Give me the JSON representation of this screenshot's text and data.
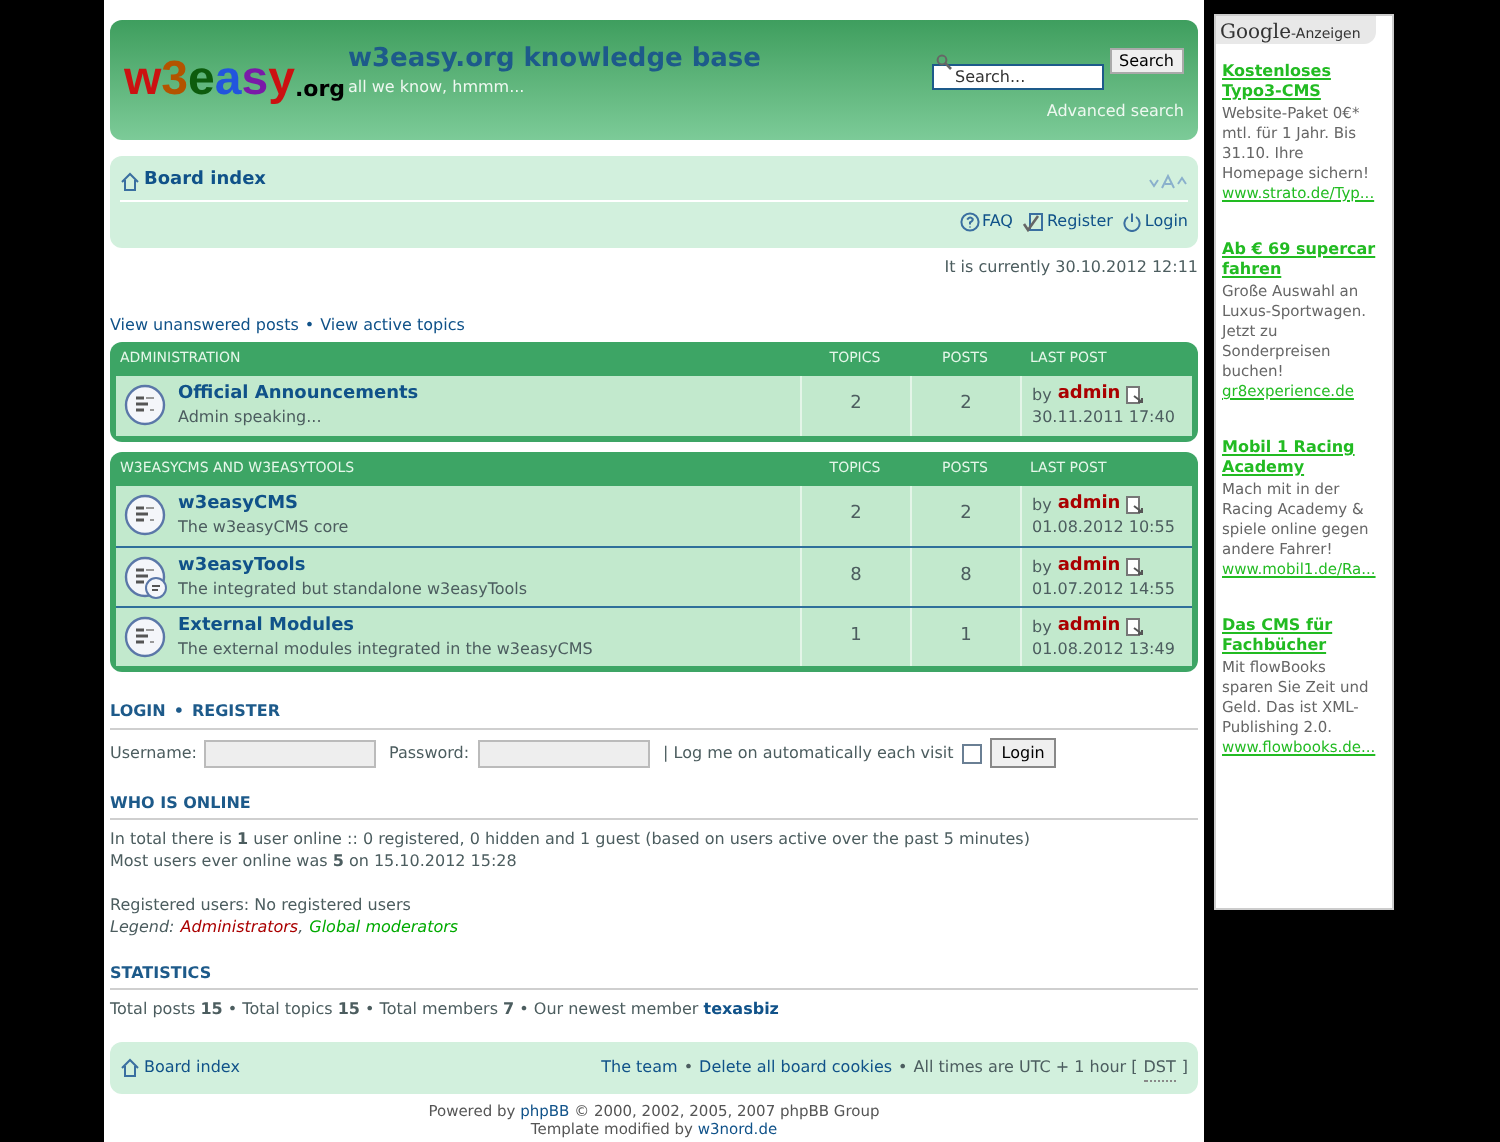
{
  "header": {
    "logo": {
      "main": "w3easy",
      "suffix": ".org"
    },
    "title": "w3easy.org knowledge base",
    "tagline": "all we know, hmmm...",
    "search": {
      "placeholder": "Search...",
      "button": "Search",
      "advanced": "Advanced search"
    }
  },
  "navbar": {
    "breadcrumb": "Board index",
    "links": [
      {
        "kind": "faq",
        "label": "FAQ"
      },
      {
        "kind": "register",
        "label": "Register"
      },
      {
        "kind": "login",
        "label": "Login"
      }
    ]
  },
  "current_time": "It is currently 30.10.2012 12:11",
  "quick_links": [
    "View unanswered posts",
    "View active topics"
  ],
  "separator": "•",
  "categories": [
    {
      "name": "ADMINISTRATION",
      "columns": [
        "TOPICS",
        "POSTS",
        "LAST POST"
      ],
      "forums": [
        {
          "title": "Official Announcements",
          "description": "Admin speaking...",
          "subforums": false,
          "topics": "2",
          "posts": "2",
          "by": "by",
          "author": "admin",
          "date": "30.11.2011 17:40"
        }
      ]
    },
    {
      "name": "W3EASYCMS AND W3EASYTOOLS",
      "columns": [
        "TOPICS",
        "POSTS",
        "LAST POST"
      ],
      "forums": [
        {
          "title": "w3easyCMS",
          "description": "The w3easyCMS core",
          "subforums": false,
          "topics": "2",
          "posts": "2",
          "by": "by",
          "author": "admin",
          "date": "01.08.2012 10:55"
        },
        {
          "title": "w3easyTools",
          "description": "The integrated but standalone w3easyTools",
          "subforums": true,
          "topics": "8",
          "posts": "8",
          "by": "by",
          "author": "admin",
          "date": "01.07.2012 14:55"
        },
        {
          "title": "External Modules",
          "description": "The external modules integrated in the w3easyCMS",
          "subforums": false,
          "topics": "1",
          "posts": "1",
          "by": "by",
          "author": "admin",
          "date": "01.08.2012 13:49"
        }
      ]
    }
  ],
  "login": {
    "heading_links": [
      "LOGIN",
      "REGISTER"
    ],
    "username_label": "Username:",
    "password_label": "Password:",
    "remember_label": "| Log me on automatically each visit",
    "remember_checked": false,
    "button": "Login"
  },
  "who_is_online": {
    "heading": "WHO IS ONLINE",
    "lines": [
      "In total there is **1** user online :: 0 registered, 0 hidden and 1 guest (based on users active over the past 5 minutes)",
      "Most users ever online was **5** on 15.10.2012 15:28"
    ],
    "registered": "Registered users: No registered users",
    "legend": {
      "label": "Legend:",
      "separator": ",",
      "groups": [
        {
          "name": "Administrators",
          "color": "#aa0000"
        },
        {
          "name": "Global moderators",
          "color": "#00aa00"
        }
      ]
    }
  },
  "statistics": {
    "heading": "STATISTICS",
    "text": "Total posts **15** • Total topics **15** • Total members **7** • Our newest member",
    "newest_member": "texasbiz"
  },
  "footer_bar": {
    "breadcrumb": "Board index",
    "links": [
      "The team",
      "Delete all board cookies"
    ],
    "timezone": "All times are UTC + 1 hour [",
    "dst": "DST",
    "close": "]"
  },
  "credits": {
    "powered_prefix": "Powered by",
    "powered_link": "phpBB",
    "powered_suffix": "© 2000, 2002, 2005, 2007 phpBB Group",
    "template_prefix": "Template modified by",
    "template_link": "w3nord.de"
  },
  "ads": {
    "header": {
      "brand": "Google",
      "label": "-Anzeigen"
    },
    "items": [
      {
        "title": "Kostenloses Typo3-CMS",
        "body": "Website-Paket 0€* mtl. für 1 Jahr. Bis 31.10. Ihre Homepage sichern!",
        "url": "www.strato.de/Typ..."
      },
      {
        "title": "Ab € 69 supercar fahren",
        "body": "Große Auswahl an Luxus-Sportwagen. Jetzt zu Sonderpreisen buchen!",
        "url": "gr8experience.de"
      },
      {
        "title": "Mobil 1 Racing Academy",
        "body": "Mach mit in der Racing Academy & spiele online gegen andere Fahrer!",
        "url": "www.mobil1.de/Ra..."
      },
      {
        "title": "Das CMS für Fachbücher",
        "body": "Mit flowBooks sparen Sie Zeit und Geld. Das ist XML-Publishing 2.0.",
        "url": "www.flowbooks.de..."
      }
    ]
  }
}
